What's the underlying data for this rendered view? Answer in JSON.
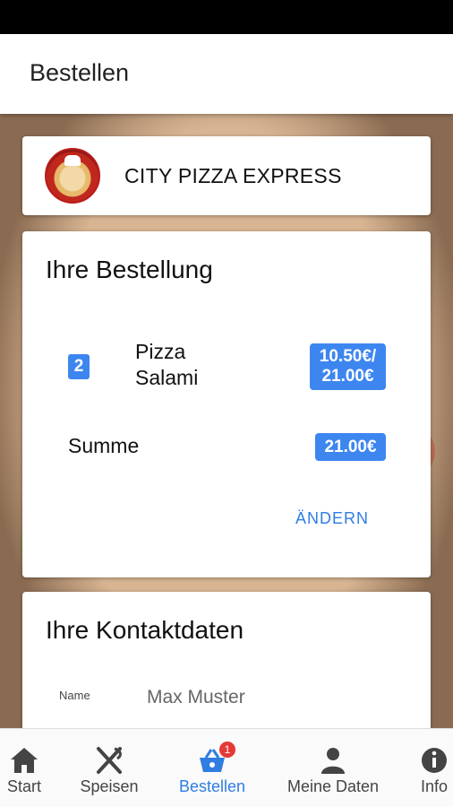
{
  "app_bar": {
    "title": "Bestellen"
  },
  "restaurant": {
    "name": "CITY PIZZA EXPRESS"
  },
  "order": {
    "title": "Ihre Bestellung",
    "items": [
      {
        "quantity": "2",
        "name": "Pizza Salami",
        "price": "10.50€/ 21.00€"
      }
    ],
    "sum_label": "Summe",
    "sum_value": "21.00€",
    "change_label": "ÄNDERN"
  },
  "contact": {
    "title": "Ihre Kontaktdaten",
    "name_label": "Name",
    "name_value": "Max Muster"
  },
  "bottom_nav": {
    "items": [
      {
        "label": "Start",
        "icon": "home-icon"
      },
      {
        "label": "Speisen",
        "icon": "utensils-icon"
      },
      {
        "label": "Bestellen",
        "icon": "basket-icon",
        "badge": "1",
        "active": true
      },
      {
        "label": "Meine Daten",
        "icon": "person-icon"
      },
      {
        "label": "Info",
        "icon": "info-icon"
      }
    ]
  },
  "colors": {
    "accent": "#3d86f0",
    "link": "#2f7de1",
    "badge": "#e53935"
  }
}
